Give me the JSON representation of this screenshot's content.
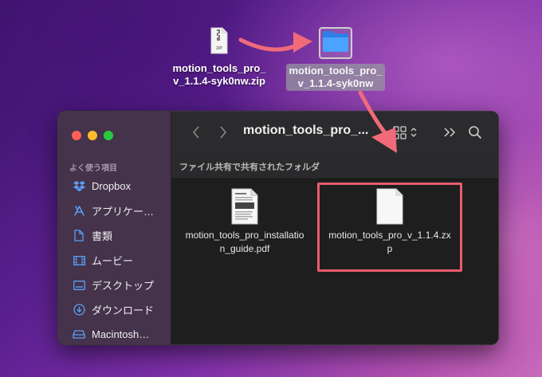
{
  "desktop": {
    "zip_file": {
      "name": "motion_tools_pro_\nv_1.1.4-syk0nw.zip",
      "line1": "motion_tools_pro_",
      "line2": "v_1.1.4-syk0nw.zip",
      "badge": "ZIP"
    },
    "folder": {
      "line1": "motion_tools_pro_",
      "line2": "v_1.1.4-syk0nw"
    }
  },
  "finder": {
    "window_title": "motion_tools_pro_...",
    "path_title": "ファイル共有で共有されたフォルダ",
    "sidebar_heading": "よく使う項目",
    "sidebar_items": [
      {
        "label": "Dropbox",
        "icon": "dropbox-icon"
      },
      {
        "label": "アプリケー…",
        "icon": "applications-icon"
      },
      {
        "label": "書類",
        "icon": "document-icon"
      },
      {
        "label": "ムービー",
        "icon": "movie-icon"
      },
      {
        "label": "デスクトップ",
        "icon": "desktop-icon"
      },
      {
        "label": "ダウンロード",
        "icon": "download-icon"
      },
      {
        "label": "Macintosh…",
        "icon": "disk-icon"
      }
    ],
    "files": [
      {
        "line1": "motion_tools_pro_installatio",
        "line2": "n_guide.pdf",
        "type": "pdf"
      },
      {
        "line1": "motion_tools_pro_v_1.1.4.zx",
        "line2": "p",
        "type": "zxp"
      }
    ]
  },
  "colors": {
    "annotation": "#e85c6a",
    "accent_folder": "#3d8ef0"
  }
}
